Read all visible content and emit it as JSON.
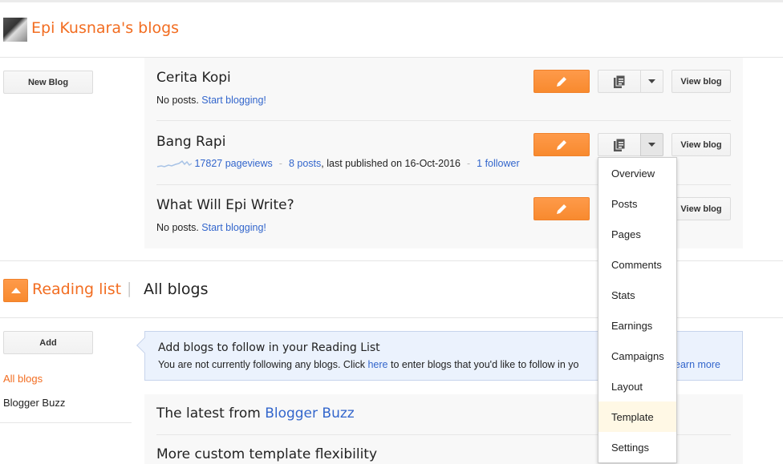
{
  "header": {
    "title": "Epi Kusnara's blogs",
    "avatar_icon": "user-avatar"
  },
  "left": {
    "new_blog": "New Blog",
    "add": "Add",
    "nav": [
      {
        "label": "All blogs",
        "active": true
      },
      {
        "label": "Blogger Buzz",
        "active": false
      }
    ]
  },
  "blogs": [
    {
      "title": "Cerita Kopi",
      "no_posts": "No posts.",
      "start": "Start blogging!"
    },
    {
      "title": "Bang Rapi",
      "pageviews": "17827 pageviews",
      "posts": "8 posts",
      "published": ", last published on 16-Oct-2016",
      "followers": "1 follower"
    },
    {
      "title": "What Will Epi Write?",
      "no_posts": "No posts.",
      "start": "Start blogging!"
    }
  ],
  "buttons": {
    "view_blog": "View blog",
    "edit_icon": "pencil",
    "posts_icon": "documents",
    "dropdown_icon": "caret-down"
  },
  "reading": {
    "title": "Reading list",
    "separator": "|",
    "subtitle": "All blogs",
    "collapse_icon": "caret-up"
  },
  "info": {
    "heading": "Add blogs to follow in your Reading List",
    "text1": "You are not currently following any blogs. Click ",
    "here": "here",
    "text2": " to enter blogs that you'd like to follow in yo",
    "learn_more": "earn more"
  },
  "feed": {
    "latest_prefix": "The latest from ",
    "latest_link": "Blogger Buzz",
    "post_title": "More custom template flexibility"
  },
  "menu": {
    "items": [
      "Overview",
      "Posts",
      "Pages",
      "Comments",
      "Stats",
      "Earnings",
      "Campaigns",
      "Layout",
      "Template",
      "Settings"
    ],
    "highlighted": "Template"
  },
  "colors": {
    "accent": "#f26d21",
    "link": "#3366cc",
    "button_orange": "#fb9240"
  }
}
